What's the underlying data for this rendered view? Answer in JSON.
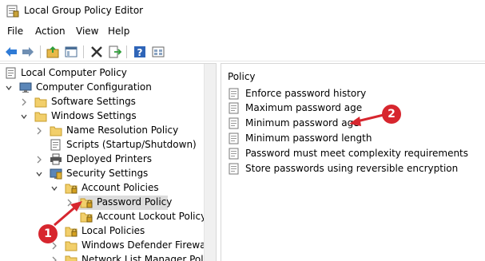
{
  "window": {
    "title": "Local Group Policy Editor",
    "icon": "policy-editor-icon"
  },
  "menu": [
    "File",
    "Action",
    "View",
    "Help"
  ],
  "toolbar": [
    "back-arrow-icon",
    "forward-arrow-icon",
    "folder-up-icon",
    "show-hide-tree-icon",
    "delete-icon",
    "export-list-icon",
    "help-icon",
    "properties-icon"
  ],
  "tree": {
    "root": "Local Computer Policy",
    "items": [
      "Computer Configuration",
      "Software Settings",
      "Windows Settings",
      "Name Resolution Policy",
      "Scripts (Startup/Shutdown)",
      "Deployed Printers",
      "Security Settings",
      "Account Policies",
      "Password Policy",
      "Account Lockout Policy",
      "Local Policies",
      "Windows Defender Firewall w",
      "Network List Manager Policie"
    ]
  },
  "policies": {
    "header": "Policy",
    "items": [
      "Enforce password history",
      "Maximum password age",
      "Minimum password age",
      "Minimum password length",
      "Password must meet complexity requirements",
      "Store passwords using reversible encryption"
    ]
  },
  "annotations": {
    "badge1": "1",
    "badge2": "2",
    "color": "#d7262e"
  }
}
